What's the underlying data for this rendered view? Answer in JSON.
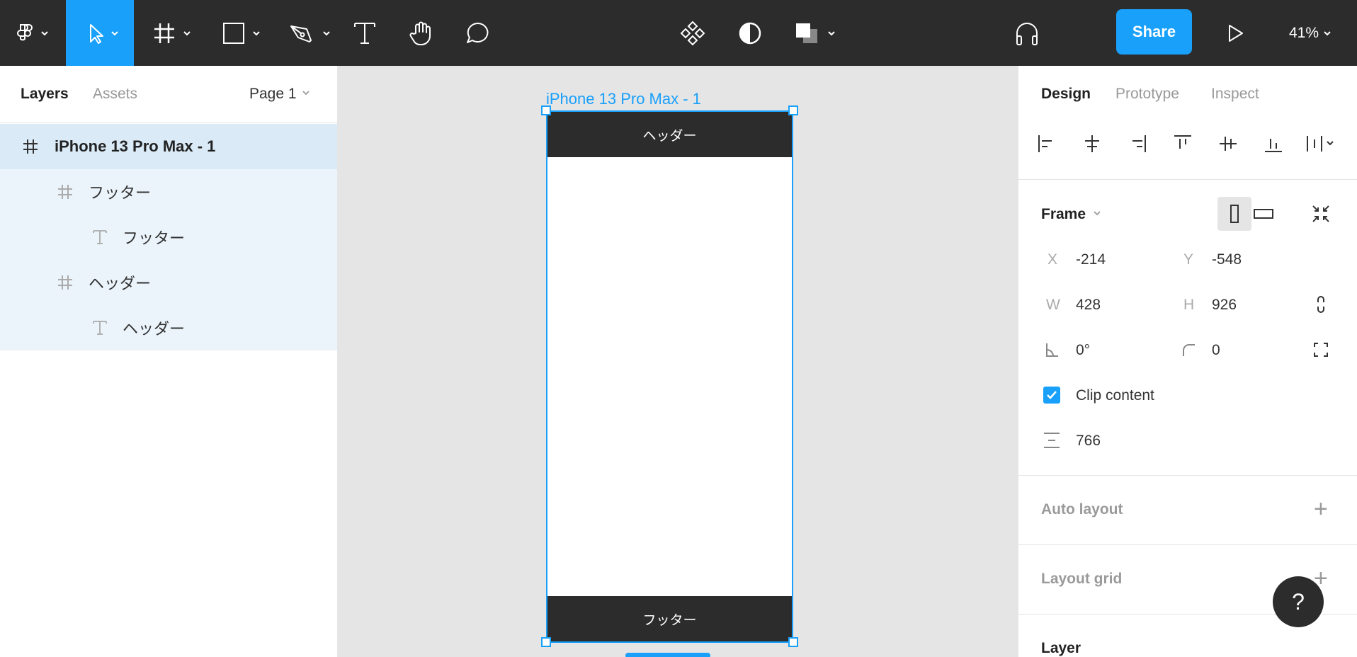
{
  "toolbar": {
    "share_label": "Share",
    "zoom": "41%"
  },
  "left_panel": {
    "tabs": [
      {
        "label": "Layers"
      },
      {
        "label": "Assets"
      }
    ],
    "page": "Page 1",
    "layers": [
      {
        "label": "iPhone 13 Pro Max - 1",
        "type": "frame"
      },
      {
        "label": "フッター",
        "type": "frame"
      },
      {
        "label": "フッター",
        "type": "text"
      },
      {
        "label": "ヘッダー",
        "type": "frame"
      },
      {
        "label": "ヘッダー",
        "type": "text"
      }
    ]
  },
  "canvas": {
    "frame_title": "iPhone 13 Pro Max - 1",
    "header_text": "ヘッダー",
    "footer_text": "フッター"
  },
  "right_panel": {
    "tabs": [
      {
        "label": "Design"
      },
      {
        "label": "Prototype"
      },
      {
        "label": "Inspect"
      }
    ],
    "frame_section": "Frame",
    "props": {
      "x_label": "X",
      "x": "-214",
      "y_label": "Y",
      "y": "-548",
      "w_label": "W",
      "w": "428",
      "h_label": "H",
      "h": "926",
      "rotation": "0°",
      "radius": "0",
      "clip_content": "Clip content",
      "spacing": "766"
    },
    "sections": {
      "auto_layout": "Auto layout",
      "layout_grid": "Layout grid",
      "layer": "Layer"
    },
    "help": "?"
  }
}
